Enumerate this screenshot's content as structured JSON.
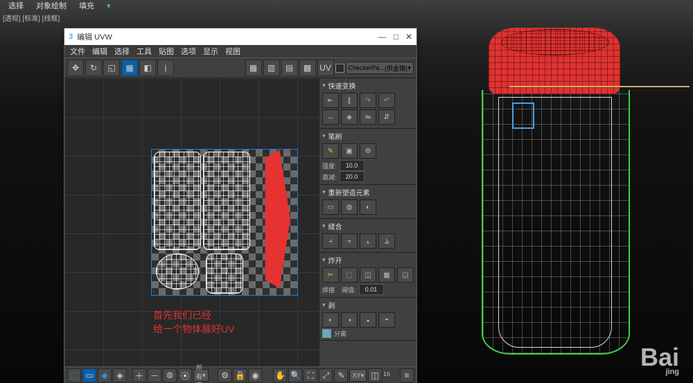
{
  "main_menu": {
    "select": "选择",
    "obj_draw": "对象绘制",
    "fill": "填充"
  },
  "tabs_line": "[透视] [标准] [线框]",
  "uvw": {
    "title": "编辑 UVW",
    "menu": {
      "file": "文件",
      "edit": "编辑",
      "select": "选择",
      "tool": "工具",
      "map": "贴图",
      "option": "选项",
      "display": "显示",
      "view": "视图"
    },
    "uv_label": "UV",
    "checker": {
      "name": "CheckerPa...",
      "mat": "(供金铬)"
    },
    "annot1": "首先我们已经",
    "annot2": "给一个物体展好UV",
    "panels": {
      "p1": "快速变换",
      "p2": "笔刷",
      "p2_s1": "强度:",
      "p2_s1v": "10.0",
      "p2_s2": "衰减:",
      "p2_s2v": "20.0",
      "p3": "重新塑造元素",
      "p4": "缝合",
      "p5": "炸开",
      "p5_sub": "焊接",
      "p5_s1": "阈值:",
      "p5_s1v": "0.01",
      "p6": "剥",
      "p6_chk": "分离"
    },
    "status": {
      "all": "所有 ID",
      "xy": "XY",
      "zoom": "16"
    }
  },
  "brand": "Bai",
  "brand_sub": "jing"
}
